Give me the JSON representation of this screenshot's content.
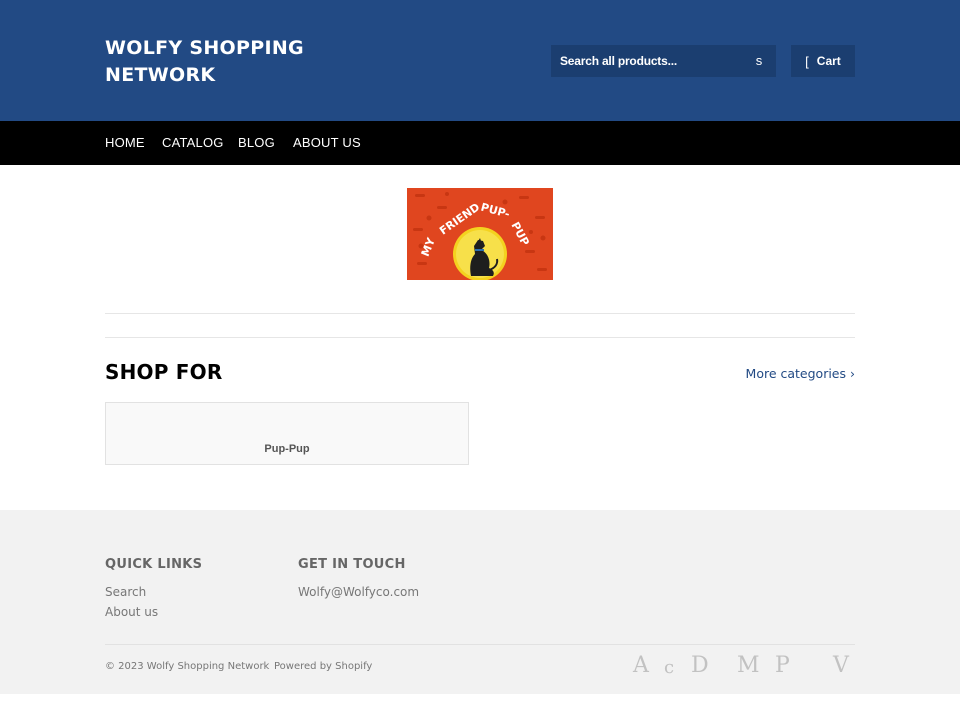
{
  "header": {
    "site_title": "WOLFY SHOPPING NETWORK",
    "search": {
      "placeholder": "Search all products...",
      "button_glyph": "s"
    },
    "cart": {
      "icon_glyph": "[",
      "label": "Cart"
    }
  },
  "nav": {
    "items": [
      {
        "label": "HOME"
      },
      {
        "label": "CATALOG"
      },
      {
        "label": "BLOG"
      },
      {
        "label": "ABOUT US"
      }
    ]
  },
  "banner": {
    "logo_text": "MY FRIEND PUP-PUP",
    "colors": {
      "background": "#e0461f",
      "circle": "#f4d21f",
      "text": "#ffffff"
    }
  },
  "shop_for": {
    "title": "SHOP FOR",
    "more_link": "More categories ›",
    "collections": [
      {
        "label": "Pup-Pup"
      }
    ]
  },
  "footer": {
    "quick_links": {
      "heading": "QUICK LINKS",
      "links": [
        "Search",
        "About us"
      ]
    },
    "get_in_touch": {
      "heading": "GET IN TOUCH",
      "email": "Wolfy@Wolfyco.com"
    },
    "copyright": "© 2023 Wolfy Shopping Network",
    "powered_by": "Powered by Shopify",
    "payment_icon_glyphs": [
      "A",
      "c",
      "D",
      "M",
      "P",
      "V"
    ]
  },
  "colors": {
    "header_bg": "#224a84",
    "search_bg": "#1b3e70",
    "nav_bg": "#000000",
    "footer_bg": "#f2f2f2",
    "link": "#224a84"
  }
}
